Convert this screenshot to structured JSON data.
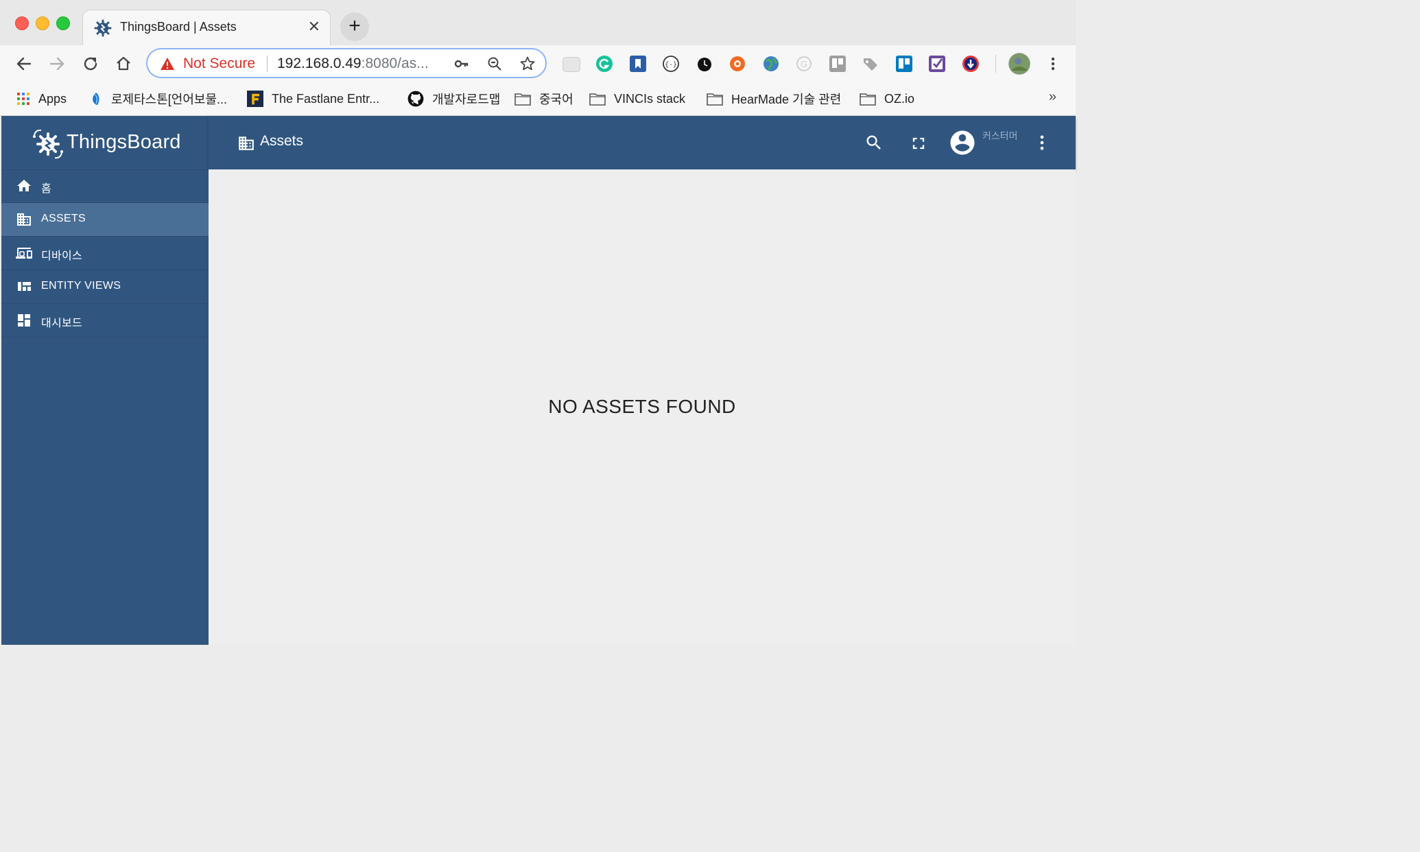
{
  "browser": {
    "tab": {
      "title": "ThingsBoard | Assets",
      "close_glyph": "✕"
    },
    "new_tab_glyph": "+",
    "omnibox": {
      "security_label": "Not Secure",
      "url_host": "192.168.0.49",
      "url_rest": ":8080/as..."
    },
    "bookmarks": [
      {
        "label": "Apps",
        "icon": "apps-grid-icon"
      },
      {
        "label": "로제타스톤[언어보물...",
        "icon": "rosetta-stone-icon"
      },
      {
        "label": "The Fastlane Entr...",
        "icon": "fastlane-icon"
      },
      {
        "label": "개발자로드맵",
        "icon": "github-icon"
      },
      {
        "label": "중국어",
        "icon": "folder-icon"
      },
      {
        "label": "VINCIs stack",
        "icon": "folder-icon"
      },
      {
        "label": "HearMade 기술 관련",
        "icon": "folder-icon"
      },
      {
        "label": "OZ.io",
        "icon": "folder-icon"
      }
    ],
    "bookmarks_more": "»"
  },
  "app": {
    "brand": "ThingsBoard",
    "menu": [
      {
        "label": "홈",
        "icon": "home-icon"
      },
      {
        "label": "ASSETS",
        "icon": "domain-icon",
        "active": true
      },
      {
        "label": "디바이스",
        "icon": "devices-icon"
      },
      {
        "label": "ENTITY VIEWS",
        "icon": "view-quilt-icon"
      },
      {
        "label": "대시보드",
        "icon": "dashboard-icon"
      }
    ],
    "header": {
      "title": "Assets",
      "user_label": "커스터머"
    },
    "empty_message": "NO ASSETS FOUND",
    "colors": {
      "primary": "#305680",
      "active_item": "#4a6f97",
      "content_bg": "#eeeeee"
    }
  }
}
